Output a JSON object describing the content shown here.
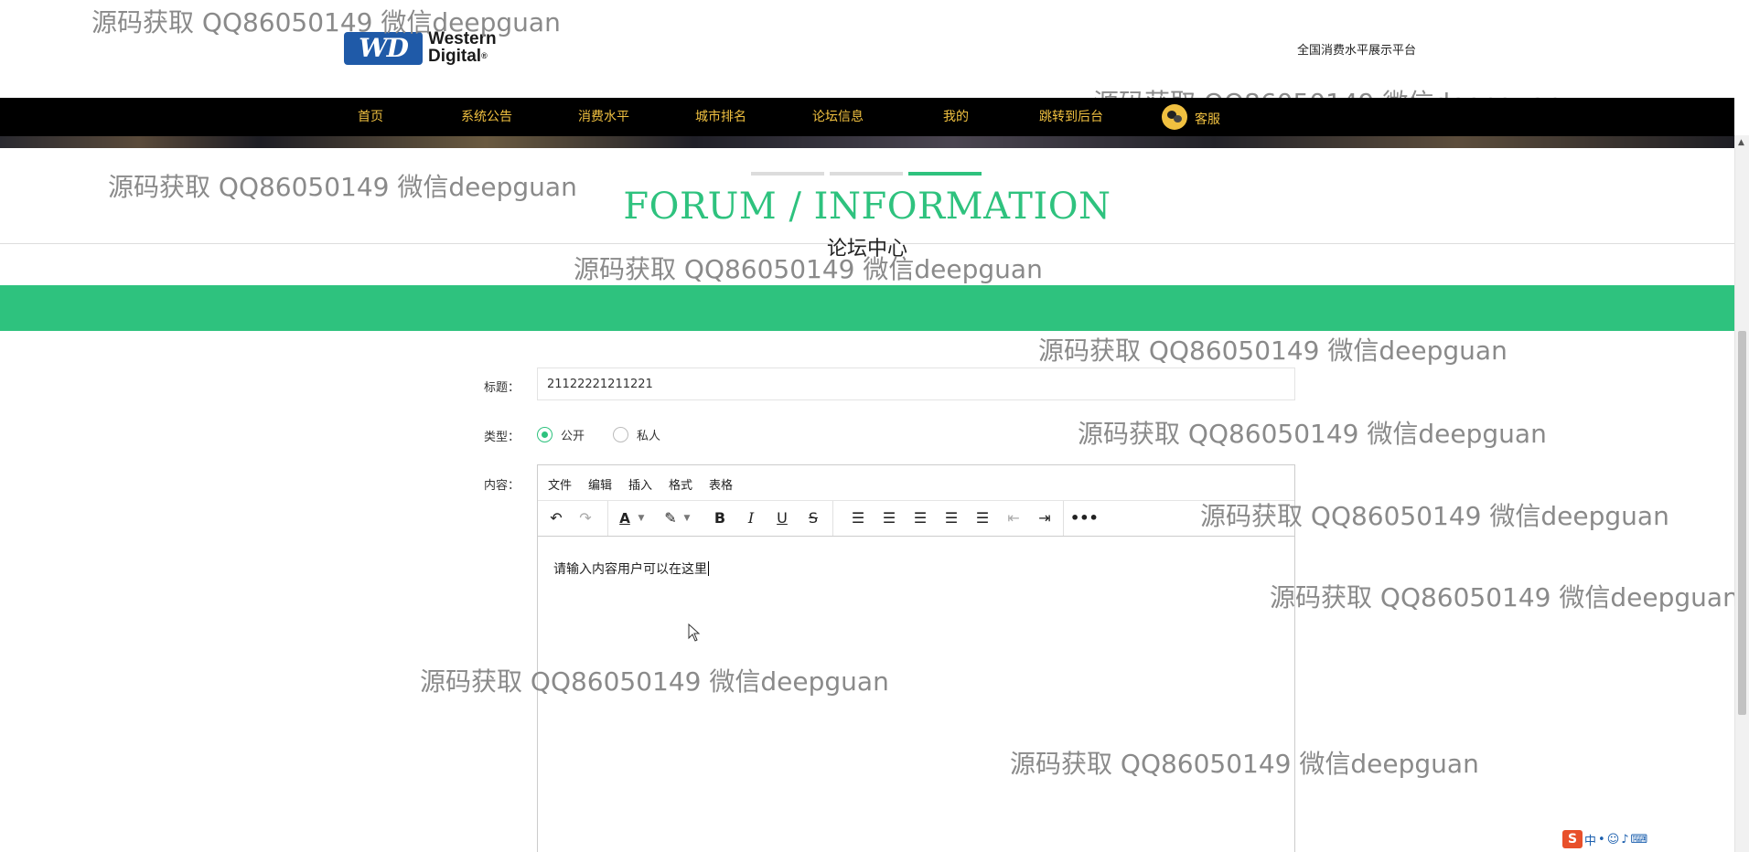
{
  "header": {
    "logo_badge": "WD",
    "logo_line1": "Western",
    "logo_line2": "Digital",
    "logo_reg": "®",
    "site_title": "全国消费水平展示平台"
  },
  "nav": {
    "items": [
      {
        "label": "首页"
      },
      {
        "label": "系统公告"
      },
      {
        "label": "消费水平"
      },
      {
        "label": "城市排名"
      },
      {
        "label": "论坛信息"
      },
      {
        "label": "我的"
      },
      {
        "label": "跳转到后台"
      }
    ],
    "service_label": "客服"
  },
  "section": {
    "title_en": "FORUM / INFORMATION",
    "title_cn": "论坛中心"
  },
  "form": {
    "title_label": "标题：",
    "title_value": "21122221211221",
    "type_label": "类型：",
    "type_options": [
      {
        "label": "公开",
        "checked": true
      },
      {
        "label": "私人",
        "checked": false
      }
    ],
    "content_label": "内容："
  },
  "editor": {
    "menus": [
      "文件",
      "编辑",
      "插入",
      "格式",
      "表格"
    ],
    "content": "请输入内容用户可以在这里"
  },
  "watermark_text": "源码获取 QQ86050149 微信deepguan",
  "ime": {
    "logo": "S",
    "mode": "中"
  },
  "colors": {
    "accent_green": "#2ec27e",
    "nav_bg": "#000000",
    "nav_text": "#f0c040",
    "logo_blue": "#1f5aa8"
  }
}
